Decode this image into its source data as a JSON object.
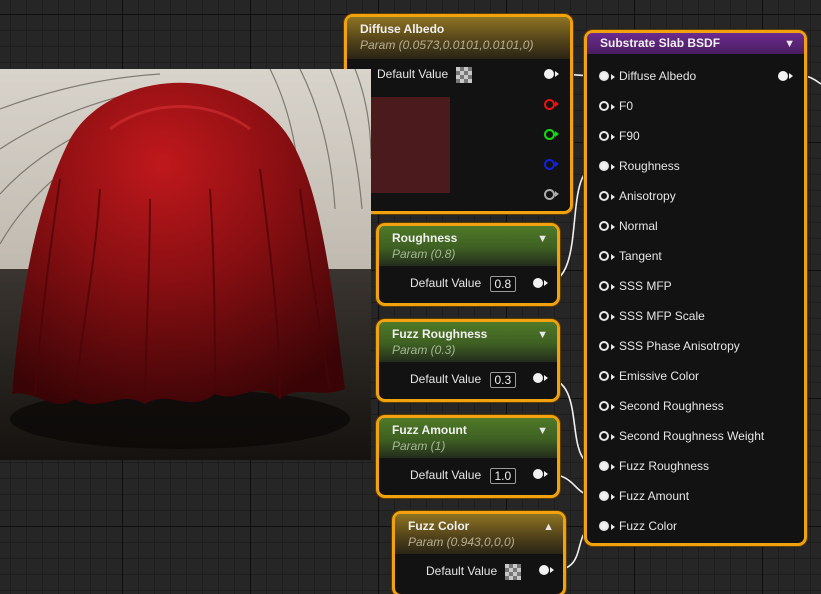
{
  "diffuse_node": {
    "title": "Diffuse Albedo",
    "subtitle": "Param (0.0573,0.0101,0.0101,0)",
    "default_label": "Default Value",
    "swatch_color": "#4a1a1c"
  },
  "roughness_node": {
    "title": "Roughness",
    "subtitle": "Param (0.8)",
    "default_label": "Default Value",
    "value": "0.8"
  },
  "fuzz_roughness_node": {
    "title": "Fuzz Roughness",
    "subtitle": "Param (0.3)",
    "default_label": "Default Value",
    "value": "0.3"
  },
  "fuzz_amount_node": {
    "title": "Fuzz Amount",
    "subtitle": "Param (1)",
    "default_label": "Default Value",
    "value": "1.0"
  },
  "fuzz_color_node": {
    "title": "Fuzz Color",
    "subtitle": "Param (0.943,0,0,0)",
    "default_label": "Default Value"
  },
  "bsdf_node": {
    "title": "Substrate Slab BSDF",
    "inputs": [
      "Diffuse Albedo",
      "F0",
      "F90",
      "Roughness",
      "Anisotropy",
      "Normal",
      "Tangent",
      "SSS MFP",
      "SSS MFP Scale",
      "SSS Phase Anisotropy",
      "Emissive Color",
      "Second Roughness",
      "Second Roughness Weight",
      "Fuzz Roughness",
      "Fuzz Amount",
      "Fuzz Color"
    ],
    "connected": [
      "Diffuse Albedo",
      "Roughness",
      "Fuzz Roughness",
      "Fuzz Amount",
      "Fuzz Color"
    ]
  },
  "colors": {
    "selection": "#f2a20e",
    "param_header": "#8e7322",
    "scalar_header": "#4f7a28",
    "bsdf_header": "#6c2a8f",
    "cloth": "#8a0f12"
  },
  "icons": [
    "chevron-down-icon",
    "chevron-up-icon",
    "checker-texture-icon"
  ]
}
